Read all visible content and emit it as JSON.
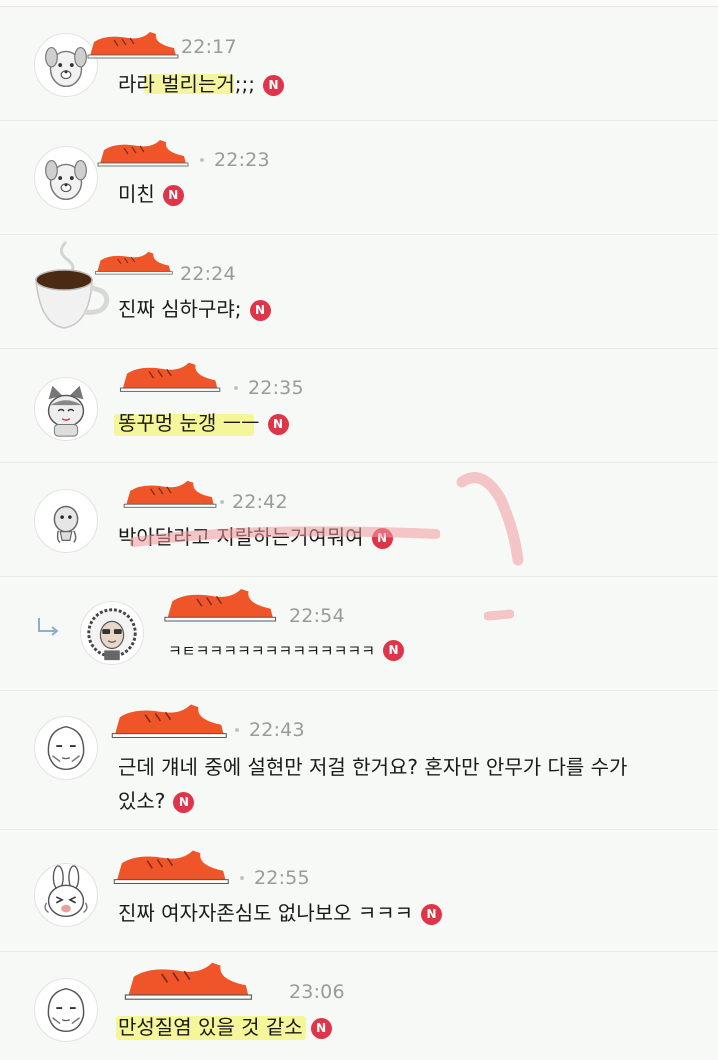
{
  "badge_label": "N",
  "colors": {
    "shoe": "#f0552a",
    "highlight": "#f3f47a",
    "new_badge": "#e0344a",
    "pen": "#f29aa0"
  },
  "comments": [
    {
      "time": "22:17",
      "text": "라라 벌리는거;;;",
      "avatar": "dog-character-icon",
      "is_reply": false
    },
    {
      "time": "22:23",
      "text": "미친",
      "avatar": "dog-character-icon",
      "is_reply": false
    },
    {
      "time": "22:24",
      "text": "진짜 심하구랴;",
      "avatar": "coffee-cup-icon",
      "is_reply": false
    },
    {
      "time": "22:35",
      "text": "똥꾸멍 눈갱 ㅡㅡ",
      "avatar": "cat-character-icon",
      "is_reply": false
    },
    {
      "time": "22:42",
      "text": "박아달라고 지랄하는거여뭐여",
      "avatar": "blob-character-icon",
      "is_reply": false
    },
    {
      "time": "22:54",
      "text": "ㅋㅌㅋㅋㅋㅋㅋㅋㅋㅋㅋㅋㅋㅋㅋ",
      "avatar": "fluffy-character-icon",
      "is_reply": true
    },
    {
      "time": "22:43",
      "text": "근데 걔네 중에 설현만 저걸 한거요? 혼자만 안무가 다를 수가",
      "text2": "있소?",
      "avatar": "peach-character-icon",
      "is_reply": false
    },
    {
      "time": "22:55",
      "text": "진짜 여자자존심도 없나보오 ㅋㅋㅋ",
      "avatar": "rabbit-character-icon",
      "is_reply": false
    },
    {
      "time": "23:06",
      "text": "만성질염 있을 것 같소",
      "avatar": "peach-character-icon",
      "is_reply": false
    }
  ]
}
